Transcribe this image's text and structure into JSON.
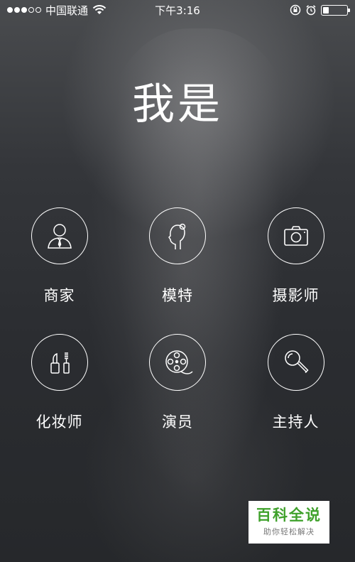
{
  "status_bar": {
    "carrier": "中国联通",
    "time": "下午3:16",
    "signal_dots_filled": 3,
    "signal_dots_total": 5,
    "battery_level": 0.25
  },
  "page": {
    "title": "我是"
  },
  "roles": [
    {
      "label": "商家",
      "icon": "merchant-icon"
    },
    {
      "label": "模特",
      "icon": "model-icon"
    },
    {
      "label": "摄影师",
      "icon": "camera-icon"
    },
    {
      "label": "化妆师",
      "icon": "makeup-icon"
    },
    {
      "label": "演员",
      "icon": "film-reel-icon"
    },
    {
      "label": "主持人",
      "icon": "microphone-icon"
    }
  ],
  "watermark": {
    "title": "百科全说",
    "subtitle": "助你轻松解决"
  },
  "colors": {
    "background": "#2b2d31",
    "foreground": "#ffffff",
    "watermark_green": "#3fa12b"
  }
}
